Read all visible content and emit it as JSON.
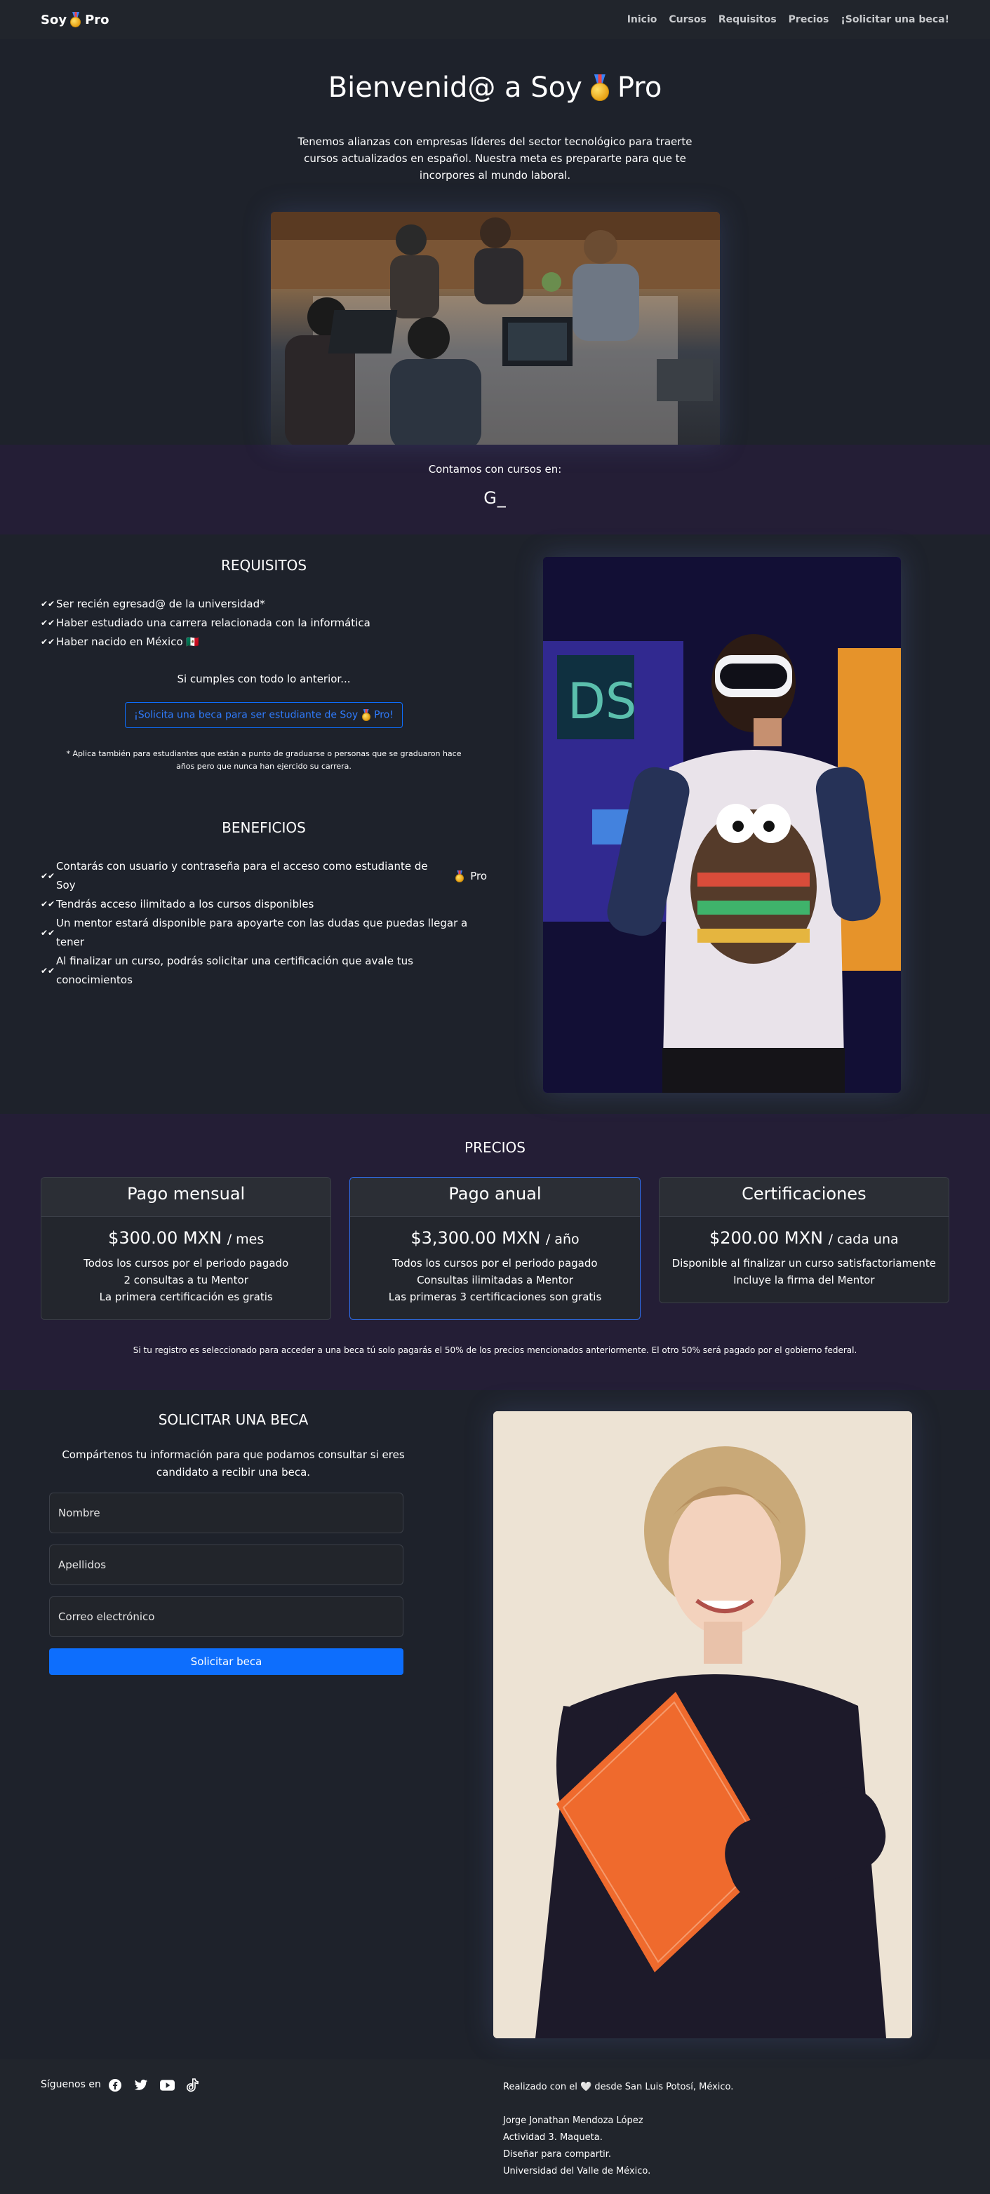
{
  "nav": {
    "brand_prefix": "Soy",
    "brand_suffix": "Pro",
    "links": [
      "Inicio",
      "Cursos",
      "Requisitos",
      "Precios",
      "¡Solicitar una beca!"
    ]
  },
  "hero": {
    "title_prefix": "Bienvenid@ a Soy",
    "title_suffix": "Pro",
    "text": "Tenemos alianzas con empresas líderes del sector tecnológico para traerte cursos actualizados en español. Nuestra meta es prepararte para que te incorpores al mundo laboral."
  },
  "courses": {
    "title": "Contamos con cursos en:",
    "typed": "G_"
  },
  "requirements": {
    "title": "REQUISITOS",
    "items": [
      "Ser recién egresad@ de la universidad*",
      "Haber estudiado una carrera relacionada con la informática",
      "Haber nacido en México 🇲🇽"
    ],
    "lead": "Si cumples con todo lo anterior...",
    "cta_prefix": "¡Solicita una beca para ser estudiante de Soy",
    "cta_suffix": "Pro!",
    "footnote": "* Aplica también para estudiantes que están a punto de graduarse o personas que se graduaron hace años pero que nunca han ejercido su carrera."
  },
  "benefits": {
    "title": "BENEFICIOS",
    "item0_prefix": "Contarás con usuario y contraseña para el acceso como estudiante de Soy",
    "item0_suffix": "Pro",
    "items": [
      "Tendrás acceso ilimitado a los cursos disponibles",
      "Un mentor estará disponible para apoyarte con las dudas que puedas llegar a tener",
      "Al finalizar un curso, podrás solicitar una certificación que avale tus conocimientos"
    ]
  },
  "prices": {
    "title": "PRECIOS",
    "cards": [
      {
        "name": "Pago mensual",
        "price": "$300.00 MXN",
        "period": "/ mes",
        "lines": [
          "Todos los cursos por el periodo pagado",
          "2 consultas a tu Mentor",
          "La primera certificación es gratis"
        ]
      },
      {
        "name": "Pago anual",
        "price": "$3,300.00 MXN",
        "period": "/ año",
        "lines": [
          "Todos los cursos por el periodo pagado",
          "Consultas ilimitadas a Mentor",
          "Las primeras 3 certificaciones son gratis"
        ]
      },
      {
        "name": "Certificaciones",
        "price": "$200.00 MXN",
        "period": "/ cada una",
        "lines": [
          "Disponible al finalizar un curso satisfactoriamente",
          "Incluye la firma del Mentor"
        ]
      }
    ],
    "note": "Si tu registro es seleccionado para acceder a una beca tú solo pagarás el 50% de los precios mencionados anteriormente. El otro 50% será pagado por el gobierno federal."
  },
  "scholarship": {
    "title": "SOLICITAR UNA BECA",
    "lead": "Compártenos tu información para que podamos consultar si eres candidato a recibir una beca.",
    "name_placeholder": "Nombre",
    "surname_placeholder": "Apellidos",
    "email_placeholder": "Correo electrónico",
    "submit": "Solicitar beca"
  },
  "footer": {
    "follow": "Síguenos en",
    "social_icons": [
      "facebook-icon",
      "twitter-icon",
      "youtube-icon",
      "tiktok-icon"
    ],
    "made_prefix": "Realizado con el",
    "made_suffix": "desde San Luis Potosí, México.",
    "credits": [
      "Jorge Jonathan Mendoza López",
      "Actividad 3. Maqueta.",
      "Diseñar para compartir.",
      "Universidad del Valle de México."
    ]
  },
  "colors": {
    "background": "#1e222b",
    "band": "#241e36",
    "primary": "#0d6efd"
  }
}
